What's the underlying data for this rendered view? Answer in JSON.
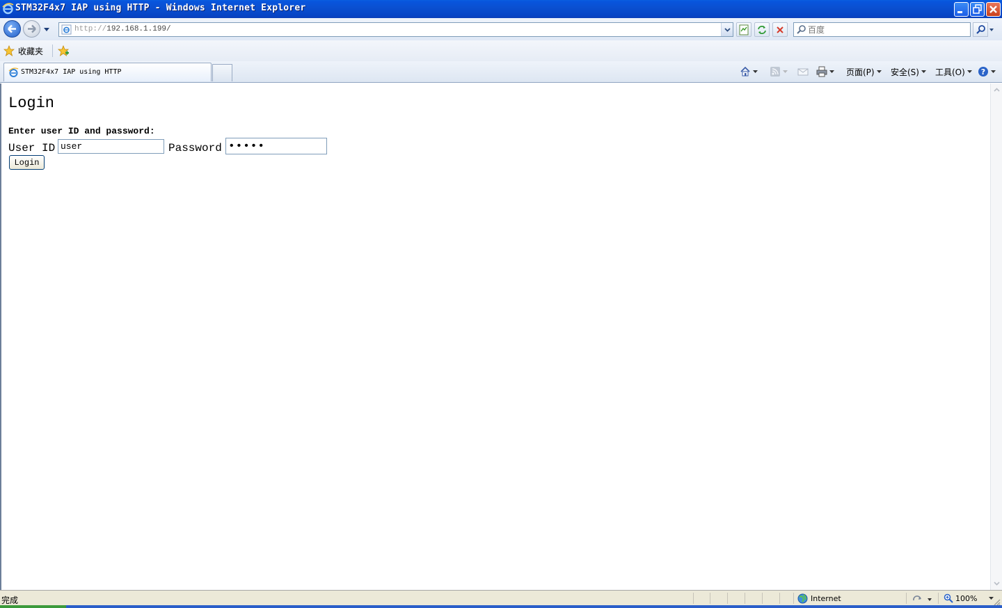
{
  "window": {
    "title": "STM32F4x7 IAP using HTTP - Windows Internet Explorer"
  },
  "nav": {
    "url_protocol": "http://",
    "url_host": "192.168.1.199/",
    "search_placeholder": "百度"
  },
  "favorites": {
    "label": "收藏夹"
  },
  "tabs": [
    {
      "label": "STM32F4x7 IAP using HTTP"
    }
  ],
  "commands": {
    "page": "页面(P)",
    "safety": "安全(S)",
    "tools": "工具(O)"
  },
  "page": {
    "heading": "Login",
    "instructions": "Enter user ID and password:",
    "user_label": "User ID",
    "user_value": "user",
    "password_label": "Password",
    "password_value": "•••••",
    "login_button": "Login"
  },
  "status": {
    "text": "完成",
    "zone": "Internet",
    "zoom": "100%"
  }
}
